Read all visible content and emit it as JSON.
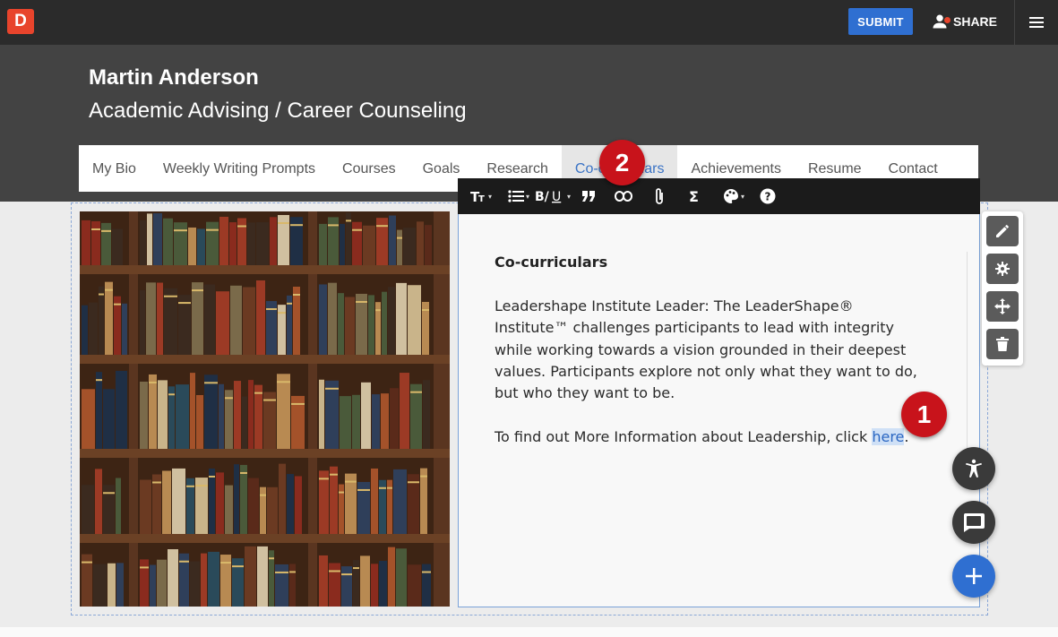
{
  "topbar": {
    "logo_letter": "D",
    "submit_label": "SUBMIT",
    "share_label": "SHARE"
  },
  "header": {
    "name": "Martin Anderson",
    "subtitle": "Academic Advising / Career Counseling"
  },
  "nav": {
    "items": [
      {
        "label": "My Bio"
      },
      {
        "label": "Weekly Writing Prompts"
      },
      {
        "label": "Courses"
      },
      {
        "label": "Goals"
      },
      {
        "label": "Research"
      },
      {
        "label": "Co-curriculars",
        "active": true
      },
      {
        "label": "Achievements"
      },
      {
        "label": "Resume"
      },
      {
        "label": "Contact"
      }
    ]
  },
  "editor": {
    "toolbar": [
      "text-size-icon",
      "list-icon",
      "bold-italic-underline-icon",
      "quote-icon",
      "link-icon",
      "attachment-icon",
      "sigma-icon",
      "palette-icon",
      "help-icon"
    ],
    "title": "Co-curriculars",
    "paragraph": "Leadershape Institute Leader: The LeaderShape® Institute™ challenges participants to lead with integrity while working towards a vision grounded in their deepest values. Participants explore not only what they want to do, but who they want to be.",
    "link_line_prefix": "To find out More Information about Leadership, click ",
    "link_text": "here",
    "link_line_suffix": "."
  },
  "side_tools": [
    "pencil-icon",
    "gear-icon",
    "move-icon",
    "trash-icon"
  ],
  "fabs": [
    "accessibility-icon",
    "chat-icon",
    "plus-icon"
  ],
  "callouts": {
    "one": "1",
    "two": "2"
  },
  "colors": {
    "accent": "#2f6fd1",
    "callout": "#c8131b",
    "logo": "#e8442c",
    "header_bg": "#434343",
    "topbar_bg": "#2b2b2b"
  }
}
